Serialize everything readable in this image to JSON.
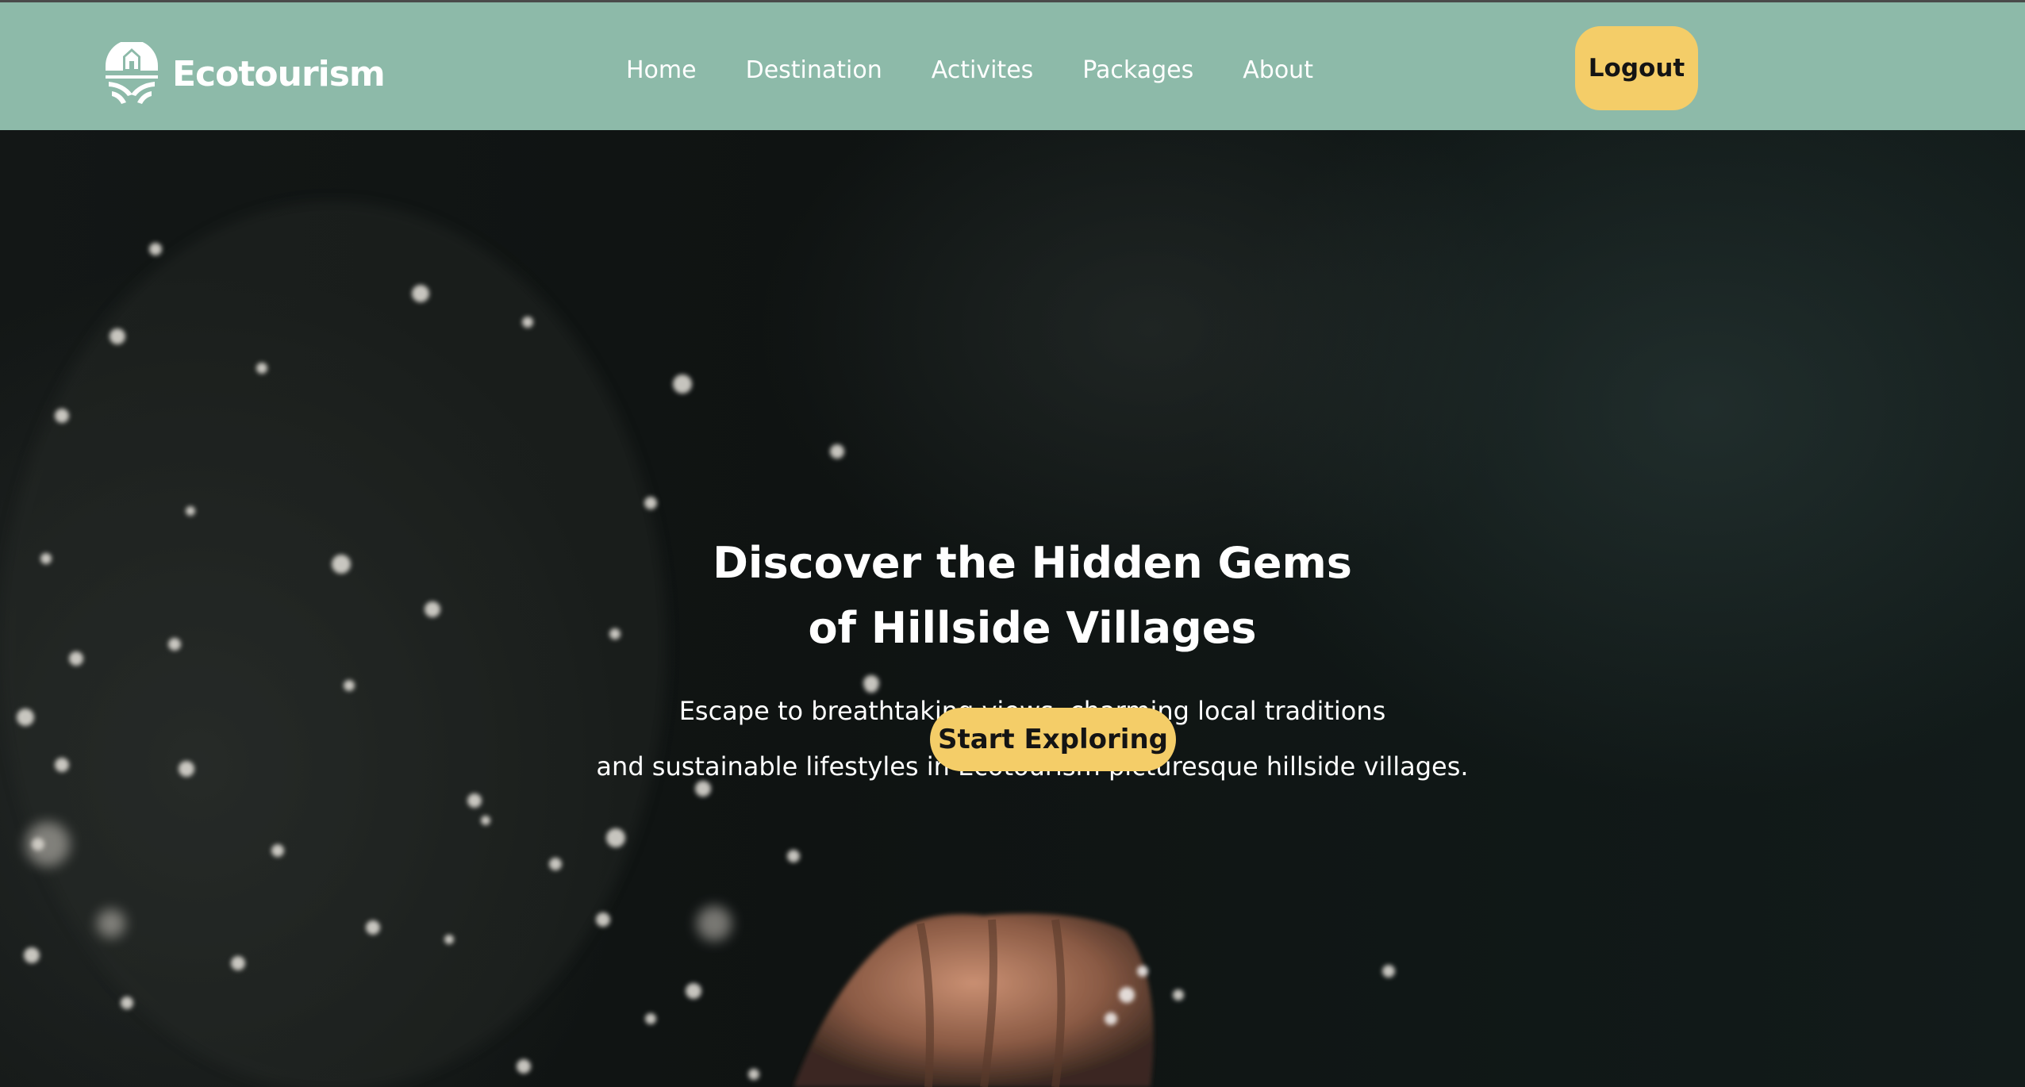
{
  "brand": {
    "name": "Ecotourism",
    "logo_icon": "village-logo-icon"
  },
  "nav": {
    "items": [
      {
        "label": "Home"
      },
      {
        "label": "Destination"
      },
      {
        "label": "Activites"
      },
      {
        "label": "Packages"
      },
      {
        "label": "About"
      }
    ],
    "logout_label": "Logout"
  },
  "hero": {
    "title_line1": "Discover the Hidden Gems",
    "title_line2": "of Hillside Villages",
    "subtitle_line1": "Escape to breathtaking views, charming local traditions",
    "subtitle_line2": "and sustainable lifestyles in Ecotourism picturesque hillside villages.",
    "cta_label": "Start Exploring",
    "background": "water-splash-hand-photo"
  },
  "colors": {
    "navbar_bg": "#8dbaa9",
    "accent_button": "#f4cd68",
    "nav_text": "#ffffff",
    "hero_overlay": "#0f1514"
  }
}
